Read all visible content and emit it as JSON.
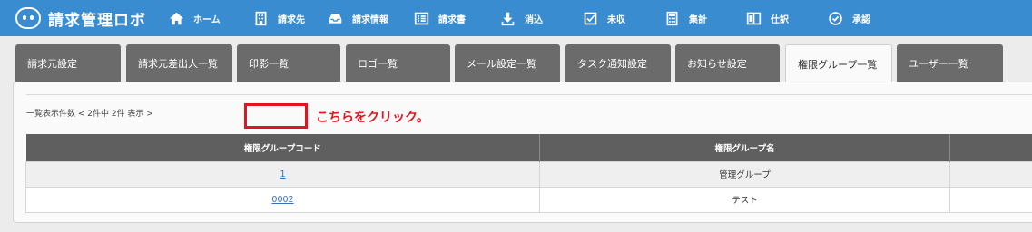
{
  "app": {
    "title": "請求管理ロボ"
  },
  "nav": [
    {
      "label": "ホーム",
      "icon": "home-icon"
    },
    {
      "label": "請求先",
      "icon": "building-icon"
    },
    {
      "label": "請求情報",
      "icon": "inbox-icon"
    },
    {
      "label": "請求書",
      "icon": "invoice-list-icon"
    },
    {
      "label": "消込",
      "icon": "download-icon"
    },
    {
      "label": "未収",
      "icon": "checkbox-icon"
    },
    {
      "label": "集計",
      "icon": "calculator-icon"
    },
    {
      "label": "仕訳",
      "icon": "journal-icon"
    },
    {
      "label": "承認",
      "icon": "check-circle-icon"
    }
  ],
  "tabs": [
    {
      "label": "請求元設定"
    },
    {
      "label": "請求元差出人一覧"
    },
    {
      "label": "印影一覧"
    },
    {
      "label": "ロゴ一覧"
    },
    {
      "label": "メール設定一覧"
    },
    {
      "label": "タスク通知設定"
    },
    {
      "label": "お知らせ設定"
    },
    {
      "label": "権限グループ一覧",
      "active": true
    },
    {
      "label": "ユーザー一覧"
    }
  ],
  "list": {
    "count_text": "一覧表示件数 < 2件中 2件 表示 >"
  },
  "table": {
    "headers": [
      "権限グループコード",
      "権限グループ名",
      ""
    ],
    "rows": [
      {
        "code": "1",
        "name": "管理グループ",
        "extra": ""
      },
      {
        "code": "0002",
        "name": "テスト",
        "extra": ""
      }
    ]
  },
  "annotation": {
    "text": "こちらをクリック。",
    "color": "#e0151f"
  },
  "colors": {
    "topbar": "#3a8cd1",
    "tab": "#6b6b6b",
    "table_header": "#5f5f5f",
    "link": "#3a6fb7"
  }
}
